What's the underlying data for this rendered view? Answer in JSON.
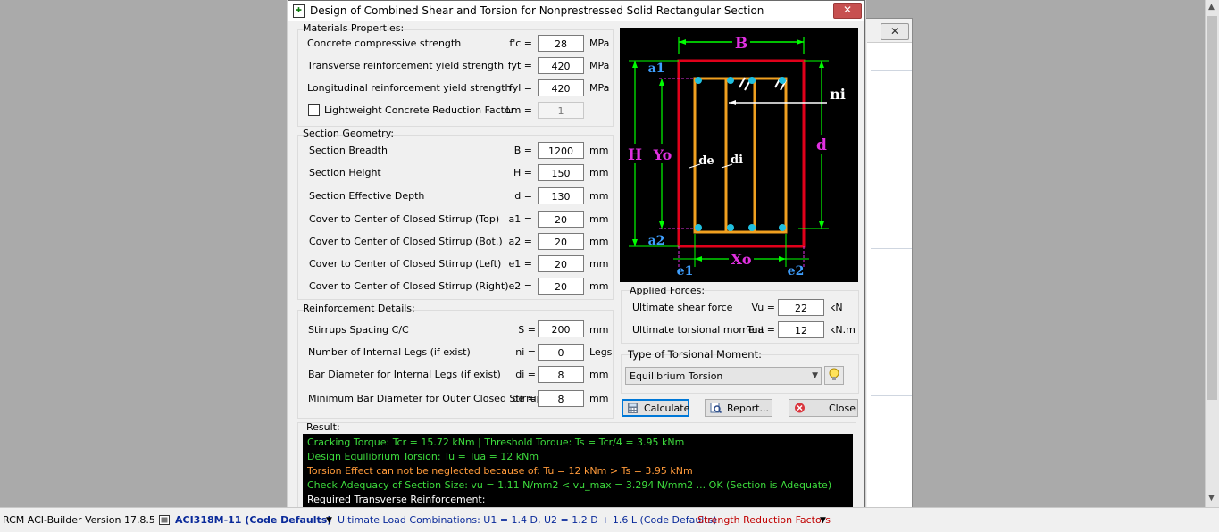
{
  "window": {
    "title": "Design of Combined Shear and Torsion for Nonprestressed Solid Rectangular Section",
    "close_symbol": "✕"
  },
  "background_window": {
    "close_symbol": "✕"
  },
  "materials": {
    "title": "Materials Properties:",
    "rows": [
      {
        "label": "Concrete compressive strength",
        "symbol": "f'c =",
        "value": "28",
        "unit": "MPa"
      },
      {
        "label": "Transverse reinforcement yield strength",
        "symbol": "fyt =",
        "value": "420",
        "unit": "MPa"
      },
      {
        "label": "Longitudinal reinforcement yield strength",
        "symbol": "fyl =",
        "value": "420",
        "unit": "MPa"
      }
    ],
    "lightweight": {
      "label": "Lightweight Concrete Reduction Factor",
      "symbol": "Lm =",
      "value": "1",
      "checked": false
    }
  },
  "geometry": {
    "title": "Section Geometry:",
    "rows": [
      {
        "label": "Section Breadth",
        "symbol": "B =",
        "value": "1200",
        "unit": "mm"
      },
      {
        "label": "Section Height",
        "symbol": "H =",
        "value": "150",
        "unit": "mm"
      },
      {
        "label": "Section Effective Depth",
        "symbol": "d =",
        "value": "130",
        "unit": "mm"
      },
      {
        "label": "Cover to Center of Closed Stirrup (Top)",
        "symbol": "a1 =",
        "value": "20",
        "unit": "mm"
      },
      {
        "label": "Cover to Center of Closed Stirrup (Bot.)",
        "symbol": "a2 =",
        "value": "20",
        "unit": "mm"
      },
      {
        "label": "Cover to Center of Closed Stirrup (Left)",
        "symbol": "e1 =",
        "value": "20",
        "unit": "mm"
      },
      {
        "label": "Cover to Center of Closed Stirrup (Right)",
        "symbol": "e2 =",
        "value": "20",
        "unit": "mm"
      }
    ]
  },
  "reinforcement": {
    "title": "Reinforcement Details:",
    "rows": [
      {
        "label": "Stirrups Spacing C/C",
        "symbol": "S =",
        "value": "200",
        "unit": "mm"
      },
      {
        "label": "Number of Internal Legs (if exist)",
        "symbol": "ni =",
        "value": "0",
        "unit": "Legs"
      },
      {
        "label": "Bar Diameter for Internal Legs (if exist)",
        "symbol": "di =",
        "value": "8",
        "unit": "mm"
      },
      {
        "label": "Minimum Bar Diameter for Outer Closed Stirrup",
        "symbol": "de =",
        "value": "8",
        "unit": "mm"
      }
    ]
  },
  "diagram": {
    "labels": {
      "B": "B",
      "a1": "a1",
      "ni": "ni",
      "H": "H",
      "Yo": "Yo",
      "d": "d",
      "de": "de",
      "di": "di",
      "a2": "a2",
      "e1": "e1",
      "Xo": "Xo",
      "e2": "e2"
    },
    "colors": {
      "section": "#e0001a",
      "stirrup": "#f0a020",
      "dim": "#00ff00",
      "magenta": "#e030e0",
      "blue": "#3fa0ff",
      "bar": "#20c0e0"
    }
  },
  "forces": {
    "title": "Applied Forces:",
    "rows": [
      {
        "label": "Ultimate shear force",
        "symbol": "Vu =",
        "value": "22",
        "unit": "kN"
      },
      {
        "label": "Ultimate torsional moment",
        "symbol": "Tua =",
        "value": "12",
        "unit": "kN.m"
      }
    ]
  },
  "torsion_type": {
    "title": "Type of Torsional Moment:",
    "selected": "Equilibrium Torsion"
  },
  "buttons": {
    "calculate": "Calculate",
    "report": "Report...",
    "close": "Close"
  },
  "result": {
    "title": "Result:",
    "lines": [
      {
        "text": "Cracking Torque: Tcr = 15.72 kNm     |     Threshold Torque: Ts = Tcr/4 = 3.95 kNm",
        "color": "#3ddc3d"
      },
      {
        "text": "Design Equilibrium Torsion: Tu = Tua = 12 kNm",
        "color": "#3ddc3d"
      },
      {
        "text": "Torsion Effect can not be neglected because of: Tu = 12 kNm > Ts = 3.95 kNm",
        "color": "#ff9a3a"
      },
      {
        "text": "Check Adequacy of Section Size: vu = 1.11 N/mm2 < vu_max = 3.294 N/mm2 ... OK (Section is Adequate)",
        "color": "#3ddc3d"
      },
      {
        "text": "Required Transverse Reinforcement:",
        "color": "#ffffff"
      }
    ]
  },
  "statusbar": {
    "app": "RCM ACI-Builder  Version 17.8.5",
    "code": "ACI318M-11 (Code Defaults)",
    "combinations": "Ultimate Load Combinations: U1 = 1.4 D, U2 = 1.2 D + 1.6 L (Code Defaults)",
    "factors": "Strength Reduction Factors",
    "colors": {
      "code": "#0a2a9a",
      "combinations": "#0a2a9a",
      "factors": "#c00000"
    }
  }
}
